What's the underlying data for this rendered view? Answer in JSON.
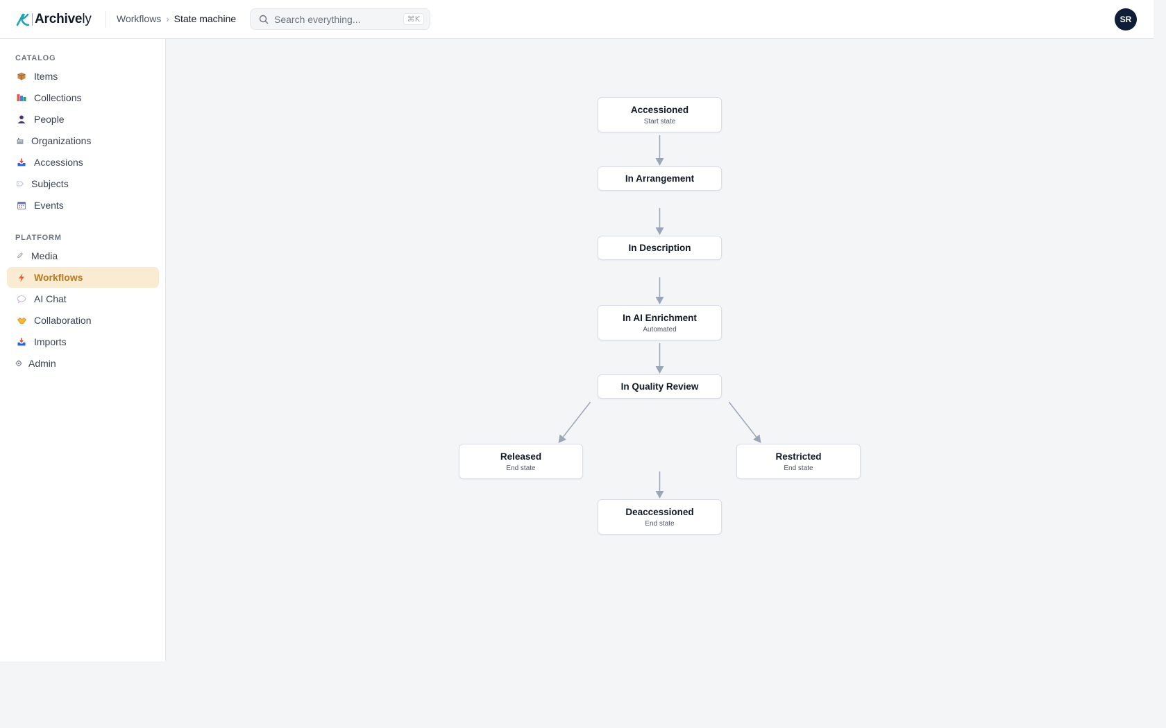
{
  "app": {
    "logo_primary": "Archive",
    "logo_suffix": "ly"
  },
  "header": {
    "breadcrumb": [
      {
        "label": "Workflows"
      },
      {
        "label": "State machine"
      }
    ],
    "breadcrumb_separator": "›",
    "search": {
      "placeholder": "Search everything...",
      "value": "",
      "shortcut": "⌘K"
    },
    "user_initials": "SR"
  },
  "sidebar": {
    "sections": [
      {
        "label": "CATALOG",
        "items": [
          {
            "label": "Items",
            "icon": "package-icon"
          },
          {
            "label": "Collections",
            "icon": "books-icon"
          },
          {
            "label": "People",
            "icon": "person-icon"
          },
          {
            "label": "Organizations",
            "icon": "building-icon"
          },
          {
            "label": "Accessions",
            "icon": "inbox-tray-icon"
          },
          {
            "label": "Subjects",
            "icon": "tag-icon"
          },
          {
            "label": "Events",
            "icon": "calendar-icon"
          }
        ]
      },
      {
        "label": "PLATFORM",
        "items": [
          {
            "label": "Media",
            "icon": "paperclip-icon"
          },
          {
            "label": "Workflows",
            "icon": "lightning-icon",
            "active": true
          },
          {
            "label": "AI Chat",
            "icon": "speech-bubble-icon"
          },
          {
            "label": "Collaboration",
            "icon": "handshake-icon"
          },
          {
            "label": "Imports",
            "icon": "inbox-tray-icon"
          },
          {
            "label": "Admin",
            "icon": "gear-icon"
          }
        ]
      }
    ]
  },
  "workflow": {
    "states": [
      {
        "id": "accessioned",
        "title": "Accessioned",
        "subtitle": "Start state"
      },
      {
        "id": "in-arrangement",
        "title": "In Arrangement",
        "subtitle": ""
      },
      {
        "id": "in-description",
        "title": "In Description",
        "subtitle": ""
      },
      {
        "id": "in-ai-enrichment",
        "title": "In AI Enrichment",
        "subtitle": "Automated"
      },
      {
        "id": "in-quality-review",
        "title": "In Quality Review",
        "subtitle": ""
      },
      {
        "id": "released",
        "title": "Released",
        "subtitle": "End state"
      },
      {
        "id": "restricted",
        "title": "Restricted",
        "subtitle": "End state"
      },
      {
        "id": "deaccessioned",
        "title": "Deaccessioned",
        "subtitle": "End state"
      }
    ],
    "transitions": [
      {
        "from": "accessioned",
        "to": "in-arrangement"
      },
      {
        "from": "in-arrangement",
        "to": "in-description"
      },
      {
        "from": "in-description",
        "to": "in-ai-enrichment"
      },
      {
        "from": "in-ai-enrichment",
        "to": "in-quality-review"
      },
      {
        "from": "in-quality-review",
        "to": "released"
      },
      {
        "from": "in-quality-review",
        "to": "restricted"
      },
      {
        "from": "in-quality-review",
        "to": "deaccessioned"
      }
    ]
  },
  "colors": {
    "accent": "#b7791f",
    "active_bg": "#f9ecd3",
    "edge": "#9aa5b8",
    "avatar_bg": "#0f1e36",
    "logo_teal": "#1fa3b8"
  }
}
